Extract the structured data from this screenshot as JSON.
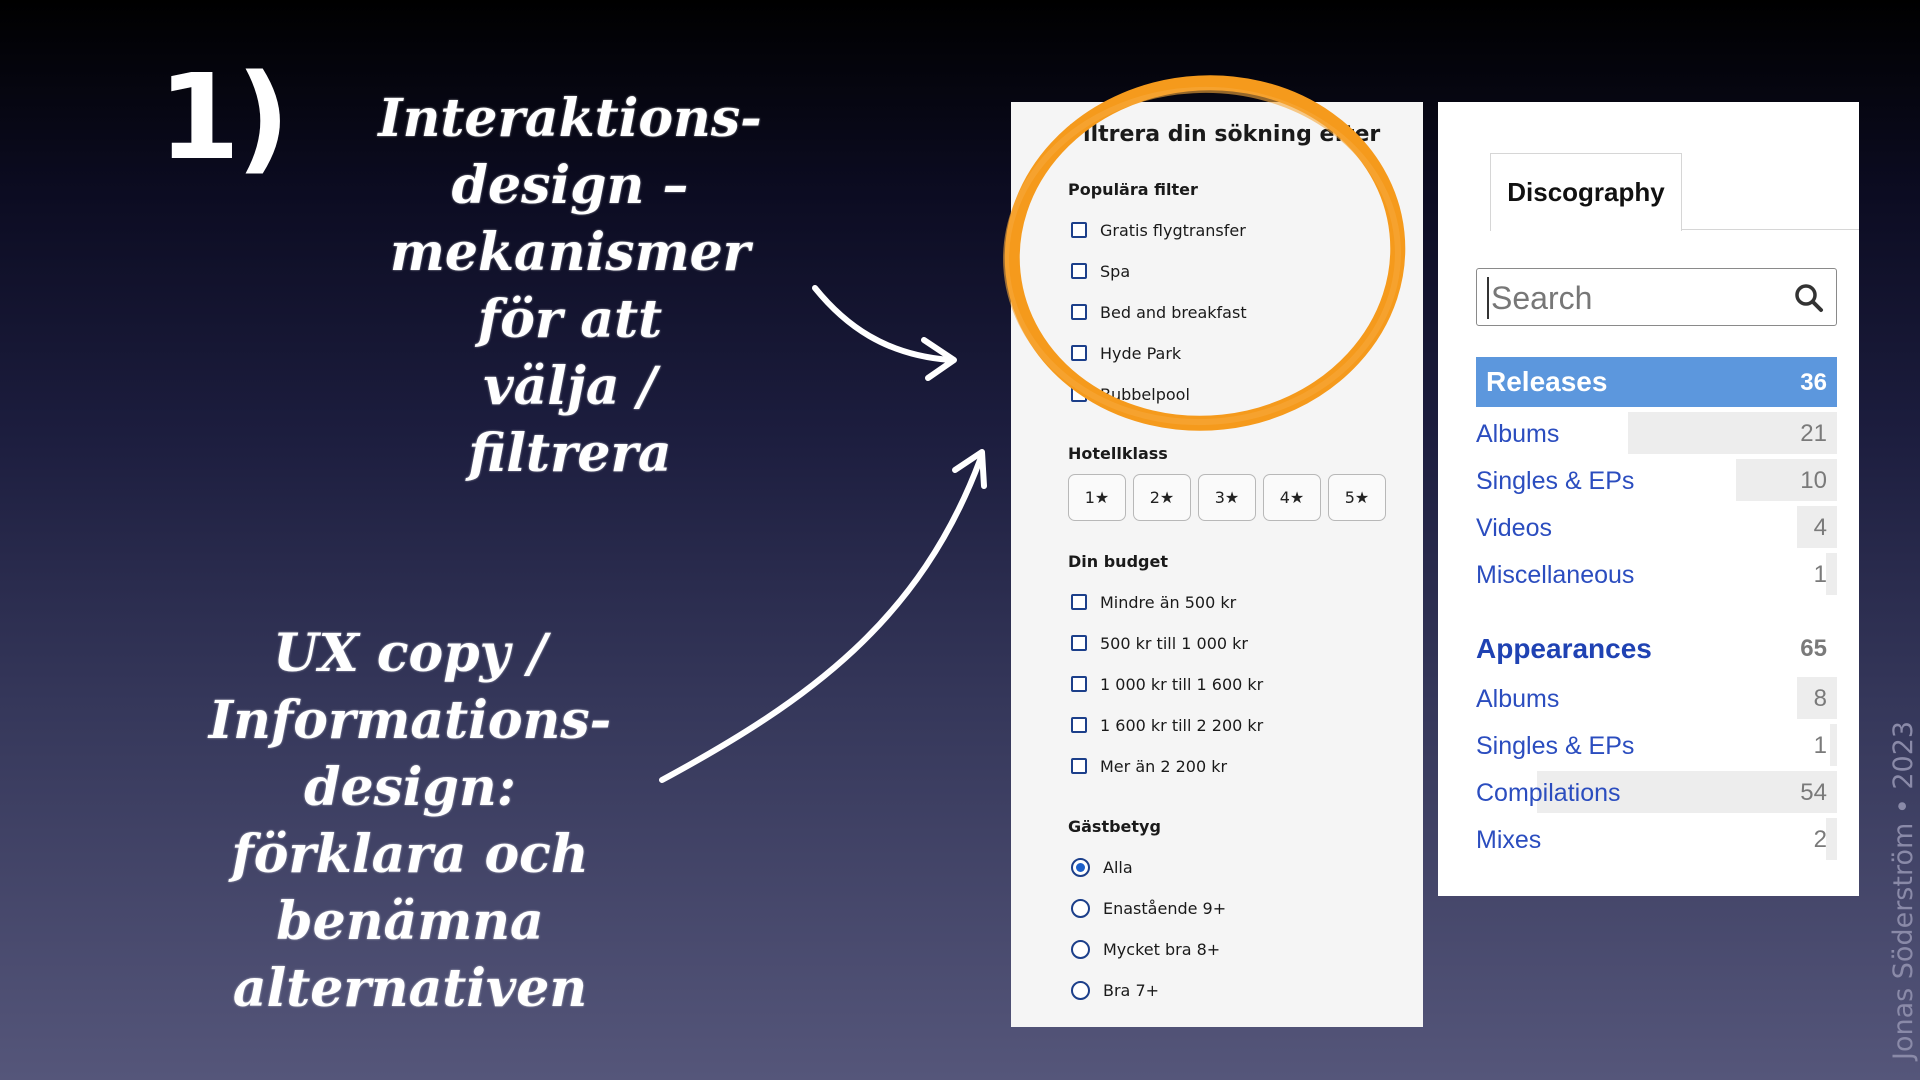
{
  "slide": {
    "number": "1)",
    "credit": "Jonas Söderström • 2023"
  },
  "notes": {
    "interaction_lines": [
      "Interaktions-",
      "design –",
      "mekanismer",
      "för att",
      "välja /",
      "filtrera"
    ],
    "copy_lines": [
      "UX copy /",
      "Informations-",
      "design:",
      "förklara och",
      "benämna",
      "alternativen"
    ]
  },
  "colors": {
    "highlight_ring": "#f59a1c",
    "accent_blue": "#5c97dd",
    "link_blue": "#2b4dbf",
    "checkbox_blue": "#1c3f8a"
  },
  "filter_panel": {
    "title": "Filtrera din sökning efter",
    "popular": {
      "heading": "Populära filter",
      "options": [
        "Gratis flygtransfer",
        "Spa",
        "Bed and breakfast",
        "Hyde Park",
        "Bubbelpool"
      ]
    },
    "hotel_class": {
      "heading": "Hotellklass",
      "stars": [
        "1★",
        "2★",
        "3★",
        "4★",
        "5★"
      ]
    },
    "budget": {
      "heading": "Din budget",
      "options": [
        "Mindre än 500 kr",
        "500 kr till 1 000 kr",
        "1 000 kr till 1 600 kr",
        "1 600 kr till 2 200 kr",
        "Mer än 2 200 kr"
      ]
    },
    "rating": {
      "heading": "Gästbetyg",
      "selected": "Alla",
      "options": [
        "Alla",
        "Enastående 9+",
        "Mycket bra 8+",
        "Bra 7+"
      ]
    }
  },
  "discography": {
    "tab": "Discography",
    "search_placeholder": "Search",
    "rows": [
      {
        "label": "Releases",
        "count": "36",
        "bar_fraction": 1.0
      },
      {
        "label": "Albums",
        "count": "21",
        "bar_fraction": 0.58
      },
      {
        "label": "Singles & EPs",
        "count": "10",
        "bar_fraction": 0.28
      },
      {
        "label": "Videos",
        "count": "4",
        "bar_fraction": 0.11
      },
      {
        "label": "Miscellaneous",
        "count": "1",
        "bar_fraction": 0.03
      },
      {
        "label": "Appearances",
        "count": "65",
        "bar_fraction": 0
      },
      {
        "label": "Albums",
        "count": "8",
        "bar_fraction": 0.11
      },
      {
        "label": "Singles & EPs",
        "count": "1",
        "bar_fraction": 0.02
      },
      {
        "label": "Compilations",
        "count": "54",
        "bar_fraction": 0.83
      },
      {
        "label": "Mixes",
        "count": "2",
        "bar_fraction": 0.03
      }
    ]
  }
}
